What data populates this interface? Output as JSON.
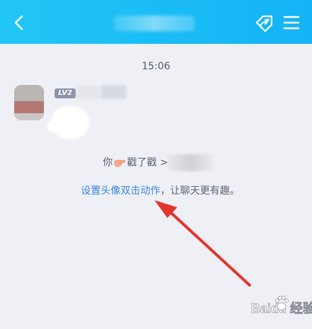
{
  "header": {
    "back_icon": "chevron-left-icon",
    "share_icon": "share-icon",
    "menu_icon": "menu-icon",
    "bg_color": "#1ebff6"
  },
  "chat": {
    "timestamp": "15:06",
    "sender_level": "LV2",
    "poke_prefix": "你",
    "poke_action": "戳了戳 >",
    "tip_link": "设置头像双击动作",
    "tip_rest": "，让聊天更有趣。",
    "link_color": "#3a86d8",
    "arrow_color": "#e5332e"
  },
  "watermark": {
    "text": "Baidu 经验"
  }
}
